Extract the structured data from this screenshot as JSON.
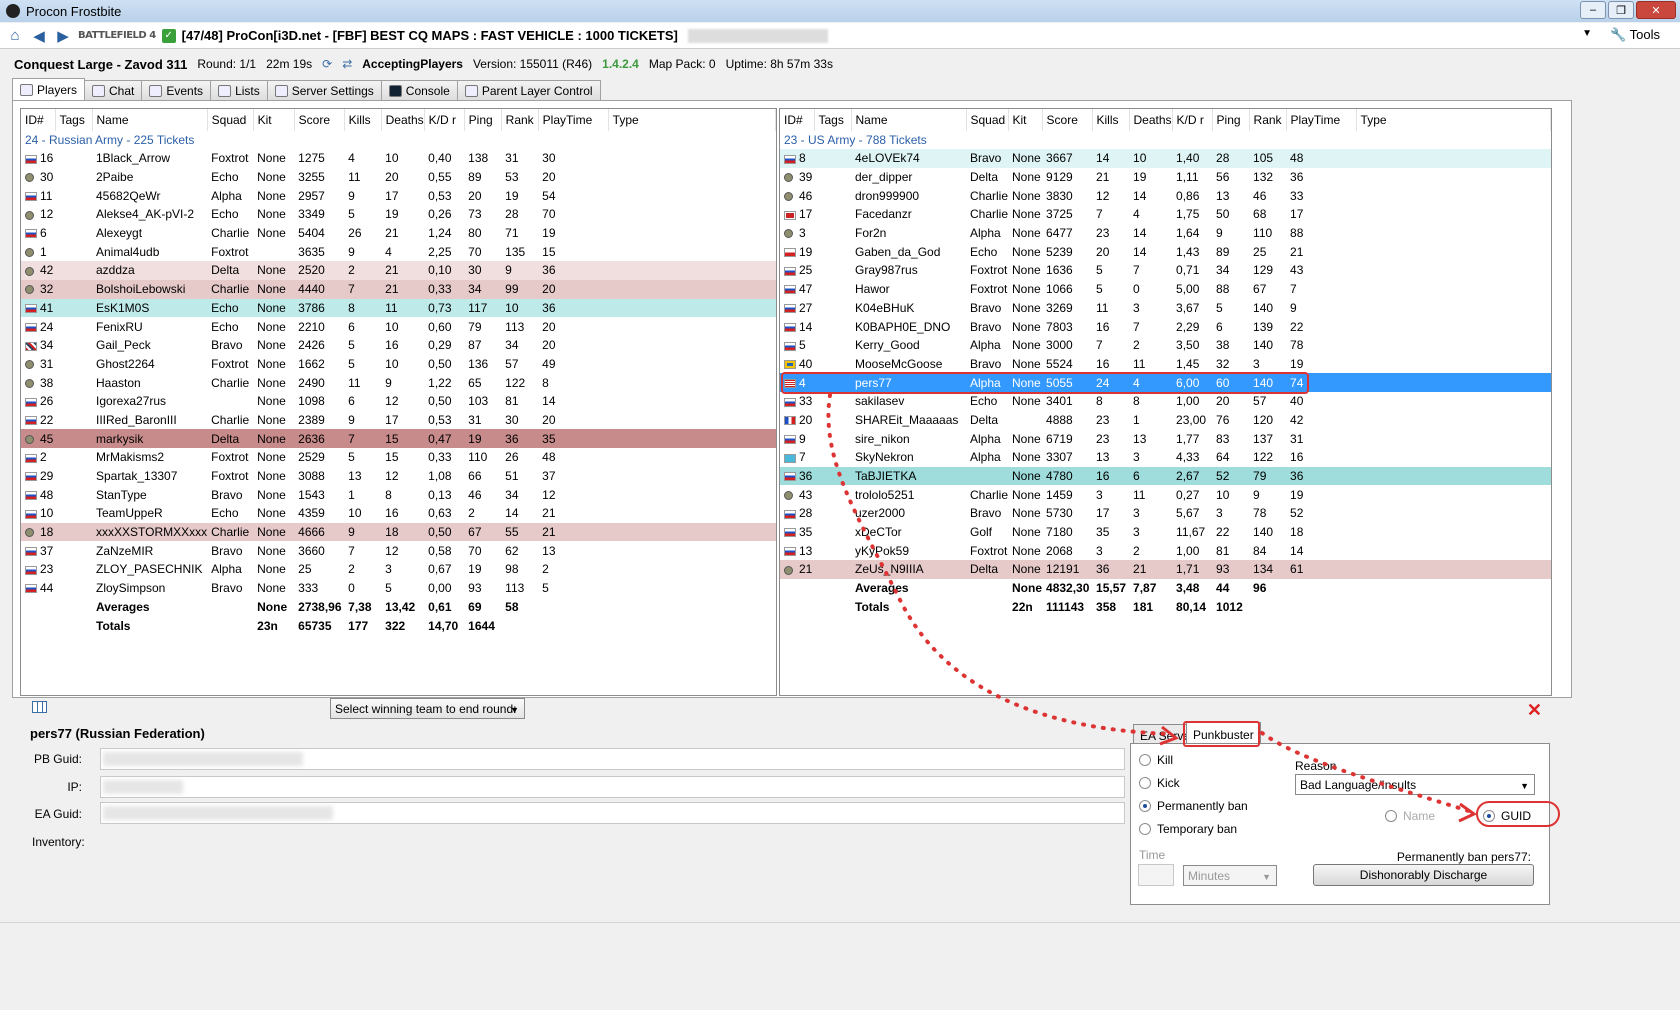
{
  "window": {
    "title": "Procon Frostbite"
  },
  "nav": {
    "server_text": "[47/48] ProCon[i3D.net - [FBF] BEST CQ MAPS : FAST VEHICLE : 1000 TICKETS]",
    "logo": "BATTLEFIELD 4",
    "tools": "Tools"
  },
  "info": {
    "map": "Conquest Large - Zavod 311",
    "round": "Round: 1/1",
    "time": "22m 19s",
    "state": "AcceptingPlayers",
    "version": "Version: 155011 (R46)",
    "procon_version": "1.4.2.4",
    "mappack": "Map Pack: 0",
    "uptime": "Uptime: 8h 57m 33s"
  },
  "tabs": [
    {
      "label": "Players"
    },
    {
      "label": "Chat"
    },
    {
      "label": "Events"
    },
    {
      "label": "Lists"
    },
    {
      "label": "Server Settings"
    },
    {
      "label": "Console"
    },
    {
      "label": "Parent Layer Control"
    }
  ],
  "columns": [
    "ID#",
    "Tags",
    "Name",
    "Squad",
    "Kit",
    "Score",
    "Kills",
    "Deaths",
    "K/D r",
    "Ping",
    "Rank",
    "PlayTime",
    "Type"
  ],
  "team1": {
    "header": "24 - Russian Army - 225 Tickets",
    "players": [
      {
        "flag": "ru",
        "id": "16",
        "name": "1Black_Arrow",
        "squad": "Foxtrot",
        "kit": "None",
        "score": "1275",
        "kills": "4",
        "deaths": "10",
        "kd": "0,40",
        "ping": "138",
        "rank": "31",
        "pt": "30",
        "style": ""
      },
      {
        "flag": "pb",
        "id": "30",
        "name": "2Paibe",
        "squad": "Echo",
        "kit": "None",
        "score": "3255",
        "kills": "11",
        "deaths": "20",
        "kd": "0,55",
        "ping": "89",
        "rank": "53",
        "pt": "20",
        "style": ""
      },
      {
        "flag": "ru",
        "id": "11",
        "name": "45682QeWr",
        "squad": "Alpha",
        "kit": "None",
        "score": "2957",
        "kills": "9",
        "deaths": "17",
        "kd": "0,53",
        "ping": "20",
        "rank": "19",
        "pt": "54",
        "style": ""
      },
      {
        "flag": "pb",
        "id": "12",
        "name": "Alekse4_AK-pVI-2",
        "squad": "Echo",
        "kit": "None",
        "score": "3349",
        "kills": "5",
        "deaths": "19",
        "kd": "0,26",
        "ping": "73",
        "rank": "28",
        "pt": "70",
        "style": ""
      },
      {
        "flag": "ru",
        "id": "6",
        "name": "Alexeygt",
        "squad": "Charlie",
        "kit": "None",
        "score": "5404",
        "kills": "26",
        "deaths": "21",
        "kd": "1,24",
        "ping": "80",
        "rank": "71",
        "pt": "19",
        "style": ""
      },
      {
        "flag": "pb",
        "id": "1",
        "name": "Animal4udb",
        "squad": "Foxtrot",
        "kit": "",
        "score": "3635",
        "kills": "9",
        "deaths": "4",
        "kd": "2,25",
        "ping": "70",
        "rank": "135",
        "pt": "15",
        "style": ""
      },
      {
        "flag": "pb",
        "id": "42",
        "name": "azddza",
        "squad": "Delta",
        "kit": "None",
        "score": "2520",
        "kills": "2",
        "deaths": "21",
        "kd": "0,10",
        "ping": "30",
        "rank": "9",
        "pt": "36",
        "style": "pink"
      },
      {
        "flag": "pb",
        "id": "32",
        "name": "BolshoiLebowski",
        "squad": "Charlie",
        "kit": "None",
        "score": "4440",
        "kills": "7",
        "deaths": "21",
        "kd": "0,33",
        "ping": "34",
        "rank": "99",
        "pt": "20",
        "style": "rose"
      },
      {
        "flag": "ru",
        "id": "41",
        "name": "EsK1M0S",
        "squad": "Echo",
        "kit": "None",
        "score": "3786",
        "kills": "8",
        "deaths": "11",
        "kd": "0,73",
        "ping": "117",
        "rank": "10",
        "pt": "36",
        "style": "cyan"
      },
      {
        "flag": "ru",
        "id": "24",
        "name": "FenixRU",
        "squad": "Echo",
        "kit": "None",
        "score": "2210",
        "kills": "6",
        "deaths": "10",
        "kd": "0,60",
        "ping": "79",
        "rank": "113",
        "pt": "20",
        "style": ""
      },
      {
        "flag": "gb",
        "id": "34",
        "name": "Gail_Peck",
        "squad": "Bravo",
        "kit": "None",
        "score": "2426",
        "kills": "5",
        "deaths": "16",
        "kd": "0,29",
        "ping": "87",
        "rank": "34",
        "pt": "20",
        "style": ""
      },
      {
        "flag": "pb",
        "id": "31",
        "name": "Ghost2264",
        "squad": "Foxtrot",
        "kit": "None",
        "score": "1662",
        "kills": "5",
        "deaths": "10",
        "kd": "0,50",
        "ping": "136",
        "rank": "57",
        "pt": "49",
        "style": ""
      },
      {
        "flag": "pb",
        "id": "38",
        "name": "Haaston",
        "squad": "Charlie",
        "kit": "None",
        "score": "2490",
        "kills": "11",
        "deaths": "9",
        "kd": "1,22",
        "ping": "65",
        "rank": "122",
        "pt": "8",
        "style": ""
      },
      {
        "flag": "ru",
        "id": "26",
        "name": "Igorexa27rus",
        "squad": "",
        "kit": "None",
        "score": "1098",
        "kills": "6",
        "deaths": "12",
        "kd": "0,50",
        "ping": "103",
        "rank": "81",
        "pt": "14",
        "style": ""
      },
      {
        "flag": "ru",
        "id": "22",
        "name": "IIIRed_BaronIII",
        "squad": "Charlie",
        "kit": "None",
        "score": "2389",
        "kills": "9",
        "deaths": "17",
        "kd": "0,53",
        "ping": "31",
        "rank": "30",
        "pt": "20",
        "style": ""
      },
      {
        "flag": "pb",
        "id": "45",
        "name": "markysik",
        "squad": "Delta",
        "kit": "None",
        "score": "2636",
        "kills": "7",
        "deaths": "15",
        "kd": "0,47",
        "ping": "19",
        "rank": "36",
        "pt": "35",
        "style": "dark"
      },
      {
        "flag": "ru",
        "id": "2",
        "name": "MrMakisms2",
        "squad": "Foxtrot",
        "kit": "None",
        "score": "2529",
        "kills": "5",
        "deaths": "15",
        "kd": "0,33",
        "ping": "110",
        "rank": "26",
        "pt": "48",
        "style": ""
      },
      {
        "flag": "ru",
        "id": "29",
        "name": "Spartak_13307",
        "squad": "Foxtrot",
        "kit": "None",
        "score": "3088",
        "kills": "13",
        "deaths": "12",
        "kd": "1,08",
        "ping": "66",
        "rank": "51",
        "pt": "37",
        "style": ""
      },
      {
        "flag": "ru",
        "id": "48",
        "name": "StanType",
        "squad": "Bravo",
        "kit": "None",
        "score": "1543",
        "kills": "1",
        "deaths": "8",
        "kd": "0,13",
        "ping": "46",
        "rank": "34",
        "pt": "12",
        "style": ""
      },
      {
        "flag": "ru",
        "id": "10",
        "name": "TeamUppeR",
        "squad": "Echo",
        "kit": "None",
        "score": "4359",
        "kills": "10",
        "deaths": "16",
        "kd": "0,63",
        "ping": "2",
        "rank": "14",
        "pt": "21",
        "style": ""
      },
      {
        "flag": "pb",
        "id": "18",
        "name": "xxxXXSTORMXXxxx",
        "squad": "Charlie",
        "kit": "None",
        "score": "4666",
        "kills": "9",
        "deaths": "18",
        "kd": "0,50",
        "ping": "67",
        "rank": "55",
        "pt": "21",
        "style": "rose"
      },
      {
        "flag": "ru",
        "id": "37",
        "name": "ZaNzeMIR",
        "squad": "Bravo",
        "kit": "None",
        "score": "3660",
        "kills": "7",
        "deaths": "12",
        "kd": "0,58",
        "ping": "70",
        "rank": "62",
        "pt": "13",
        "style": ""
      },
      {
        "flag": "ru",
        "id": "23",
        "name": "ZLOY_PASECHNIK",
        "squad": "Alpha",
        "kit": "None",
        "score": "25",
        "kills": "2",
        "deaths": "3",
        "kd": "0,67",
        "ping": "19",
        "rank": "98",
        "pt": "2",
        "style": ""
      },
      {
        "flag": "ru",
        "id": "44",
        "name": "ZloySimpson",
        "squad": "Bravo",
        "kit": "None",
        "score": "333",
        "kills": "0",
        "deaths": "5",
        "kd": "0,00",
        "ping": "93",
        "rank": "113",
        "pt": "5",
        "style": ""
      }
    ],
    "averages": {
      "label": "Averages",
      "kit": "None",
      "score": "2738,96",
      "kills": "7,38",
      "deaths": "13,42",
      "kd": "0,61",
      "ping": "69",
      "rank": "58"
    },
    "totals": {
      "label": "Totals",
      "kit": "23n",
      "score": "65735",
      "kills": "177",
      "deaths": "322",
      "kd": "14,70",
      "ping": "1644"
    }
  },
  "team2": {
    "header": "23 - US Army - 788 Tickets",
    "players": [
      {
        "flag": "ru",
        "id": "8",
        "name": "4eLOVEk74",
        "squad": "Bravo",
        "kit": "None",
        "score": "3667",
        "kills": "14",
        "deaths": "10",
        "kd": "1,40",
        "ping": "28",
        "rank": "105",
        "pt": "48",
        "style": "lightcyan"
      },
      {
        "flag": "pb",
        "id": "39",
        "name": "der_dipper",
        "squad": "Delta",
        "kit": "None",
        "score": "9129",
        "kills": "21",
        "deaths": "19",
        "kd": "1,11",
        "ping": "56",
        "rank": "132",
        "pt": "36",
        "style": ""
      },
      {
        "flag": "pb",
        "id": "46",
        "name": "dron999900",
        "squad": "Charlie",
        "kit": "None",
        "score": "3830",
        "kills": "12",
        "deaths": "14",
        "kd": "0,86",
        "ping": "13",
        "rank": "46",
        "pt": "33",
        "style": ""
      },
      {
        "flag": "no",
        "id": "17",
        "name": "Facedanzr",
        "squad": "Charlie",
        "kit": "None",
        "score": "3725",
        "kills": "7",
        "deaths": "4",
        "kd": "1,75",
        "ping": "50",
        "rank": "68",
        "pt": "17",
        "style": ""
      },
      {
        "flag": "pb",
        "id": "3",
        "name": "For2n",
        "squad": "Alpha",
        "kit": "None",
        "score": "6477",
        "kills": "23",
        "deaths": "14",
        "kd": "1,64",
        "ping": "9",
        "rank": "110",
        "pt": "88",
        "style": ""
      },
      {
        "flag": "pl",
        "id": "19",
        "name": "Gaben_da_God",
        "squad": "Echo",
        "kit": "None",
        "score": "5239",
        "kills": "20",
        "deaths": "14",
        "kd": "1,43",
        "ping": "89",
        "rank": "25",
        "pt": "21",
        "style": ""
      },
      {
        "flag": "ru",
        "id": "25",
        "name": "Gray987rus",
        "squad": "Foxtrot",
        "kit": "None",
        "score": "1636",
        "kills": "5",
        "deaths": "7",
        "kd": "0,71",
        "ping": "34",
        "rank": "129",
        "pt": "43",
        "style": ""
      },
      {
        "flag": "ru",
        "id": "47",
        "name": "Hawor",
        "squad": "Foxtrot",
        "kit": "None",
        "score": "1066",
        "kills": "5",
        "deaths": "0",
        "kd": "5,00",
        "ping": "88",
        "rank": "67",
        "pt": "7",
        "style": ""
      },
      {
        "flag": "ru",
        "id": "27",
        "name": "K04eBHuK",
        "squad": "Bravo",
        "kit": "None",
        "score": "3269",
        "kills": "11",
        "deaths": "3",
        "kd": "3,67",
        "ping": "5",
        "rank": "140",
        "pt": "9",
        "style": ""
      },
      {
        "flag": "ru",
        "id": "14",
        "name": "K0BAPH0E_DNO",
        "squad": "Bravo",
        "kit": "None",
        "score": "7803",
        "kills": "16",
        "deaths": "7",
        "kd": "2,29",
        "ping": "6",
        "rank": "139",
        "pt": "22",
        "style": ""
      },
      {
        "flag": "ru",
        "id": "5",
        "name": "Kerry_Good",
        "squad": "Alpha",
        "kit": "None",
        "score": "3000",
        "kills": "7",
        "deaths": "2",
        "kd": "3,50",
        "ping": "38",
        "rank": "140",
        "pt": "78",
        "style": ""
      },
      {
        "flag": "se",
        "id": "40",
        "name": "MooseMcGoose",
        "squad": "Bravo",
        "kit": "None",
        "score": "5524",
        "kills": "16",
        "deaths": "11",
        "kd": "1,45",
        "ping": "32",
        "rank": "3",
        "pt": "19",
        "style": ""
      },
      {
        "flag": "us",
        "id": "4",
        "name": "pers77",
        "squad": "Alpha",
        "kit": "None",
        "score": "5055",
        "kills": "24",
        "deaths": "4",
        "kd": "6,00",
        "ping": "60",
        "rank": "140",
        "pt": "74",
        "style": "sel"
      },
      {
        "flag": "ru",
        "id": "33",
        "name": "sakilasev",
        "squad": "Echo",
        "kit": "None",
        "score": "3401",
        "kills": "8",
        "deaths": "8",
        "kd": "1,00",
        "ping": "20",
        "rank": "57",
        "pt": "40",
        "style": ""
      },
      {
        "flag": "fr",
        "id": "20",
        "name": "SHAREit_Maaaaas",
        "squad": "Delta",
        "kit": "",
        "score": "4888",
        "kills": "23",
        "deaths": "1",
        "kd": "23,00",
        "ping": "76",
        "rank": "120",
        "pt": "42",
        "style": ""
      },
      {
        "flag": "ru",
        "id": "9",
        "name": "sire_nikon",
        "squad": "Alpha",
        "kit": "None",
        "score": "6719",
        "kills": "23",
        "deaths": "13",
        "kd": "1,77",
        "ping": "83",
        "rank": "137",
        "pt": "31",
        "style": ""
      },
      {
        "flag": "kz",
        "id": "7",
        "name": "SkyNekron",
        "squad": "Alpha",
        "kit": "None",
        "score": "3307",
        "kills": "13",
        "deaths": "3",
        "kd": "4,33",
        "ping": "64",
        "rank": "122",
        "pt": "16",
        "style": ""
      },
      {
        "flag": "ru",
        "id": "36",
        "name": "TaBJIETKA",
        "squad": "",
        "kit": "None",
        "score": "4780",
        "kills": "16",
        "deaths": "6",
        "kd": "2,67",
        "ping": "52",
        "rank": "79",
        "pt": "36",
        "style": "teal"
      },
      {
        "flag": "pb",
        "id": "43",
        "name": "trololo5251",
        "squad": "Charlie",
        "kit": "None",
        "score": "1459",
        "kills": "3",
        "deaths": "11",
        "kd": "0,27",
        "ping": "10",
        "rank": "9",
        "pt": "19",
        "style": ""
      },
      {
        "flag": "ru",
        "id": "28",
        "name": "uzer2000",
        "squad": "Bravo",
        "kit": "None",
        "score": "5730",
        "kills": "17",
        "deaths": "3",
        "kd": "5,67",
        "ping": "3",
        "rank": "78",
        "pt": "52",
        "style": ""
      },
      {
        "flag": "ru",
        "id": "35",
        "name": "xDeCTor",
        "squad": "Golf",
        "kit": "None",
        "score": "7180",
        "kills": "35",
        "deaths": "3",
        "kd": "11,67",
        "ping": "22",
        "rank": "140",
        "pt": "18",
        "style": ""
      },
      {
        "flag": "ru",
        "id": "13",
        "name": "yKyPok59",
        "squad": "Foxtrot",
        "kit": "None",
        "score": "2068",
        "kills": "3",
        "deaths": "2",
        "kd": "1,00",
        "ping": "81",
        "rank": "84",
        "pt": "14",
        "style": ""
      },
      {
        "flag": "pb",
        "id": "21",
        "name": "ZeUs_N9IIIA",
        "squad": "Delta",
        "kit": "None",
        "score": "12191",
        "kills": "36",
        "deaths": "21",
        "kd": "1,71",
        "ping": "93",
        "rank": "134",
        "pt": "61",
        "style": "rose"
      }
    ],
    "averages": {
      "label": "Averages",
      "kit": "None",
      "score": "4832,30",
      "kills": "15,57",
      "deaths": "7,87",
      "kd": "3,48",
      "ping": "44",
      "rank": "96"
    },
    "totals": {
      "label": "Totals",
      "kit": "22n",
      "score": "111143",
      "kills": "358",
      "deaths": "181",
      "kd": "80,14",
      "ping": "1012"
    }
  },
  "details": {
    "end_round_select": "Select winning team to end round:",
    "player_title": "pers77 (Russian Federation)",
    "pb_guid_label": "PB Guid:",
    "ip_label": "IP:",
    "ea_guid_label": "EA Guid:",
    "inventory_label": "Inventory:"
  },
  "ban": {
    "tab_ea": "EA Server",
    "tab_pb": "Punkbuster",
    "kill": "Kill",
    "kick": "Kick",
    "perm": "Permanently ban",
    "temp": "Temporary ban",
    "reason_label": "Reason",
    "reason_value": "Bad Language/Insults",
    "by_name": "Name",
    "by_guid": "GUID",
    "time_label": "Time",
    "time_unit": "Minutes",
    "summary": "Permanently ban pers77:",
    "action_button": "Dishonorably Discharge"
  },
  "colors": {
    "selection": "#3399ff",
    "team_header": "#2b5fa8",
    "highlight_outline": "#dd3333"
  }
}
